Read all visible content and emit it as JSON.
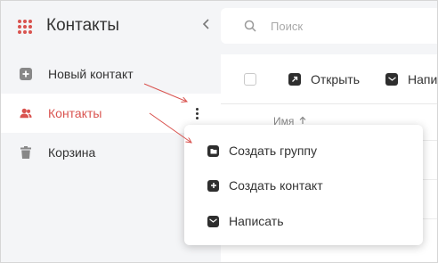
{
  "app": {
    "title": "Контакты",
    "collapse_icon": "chevron-left-icon",
    "accent": "#d9534f"
  },
  "sidebar": {
    "items": [
      {
        "label": "Новый контакт",
        "icon": "plus-square-icon"
      },
      {
        "label": "Контакты",
        "icon": "users-icon",
        "active": true
      },
      {
        "label": "Корзина",
        "icon": "trash-icon"
      }
    ]
  },
  "search": {
    "placeholder": "Поиск",
    "value": ""
  },
  "toolbar": {
    "open_label": "Открыть",
    "write_label": "Напи"
  },
  "table": {
    "column_name": "Имя",
    "sort_icon": "arrow-up-icon"
  },
  "context_menu": {
    "items": [
      {
        "label": "Создать группу",
        "icon": "folder-icon"
      },
      {
        "label": "Создать контакт",
        "icon": "plus-icon"
      },
      {
        "label": "Написать",
        "icon": "envelope-icon"
      }
    ]
  }
}
